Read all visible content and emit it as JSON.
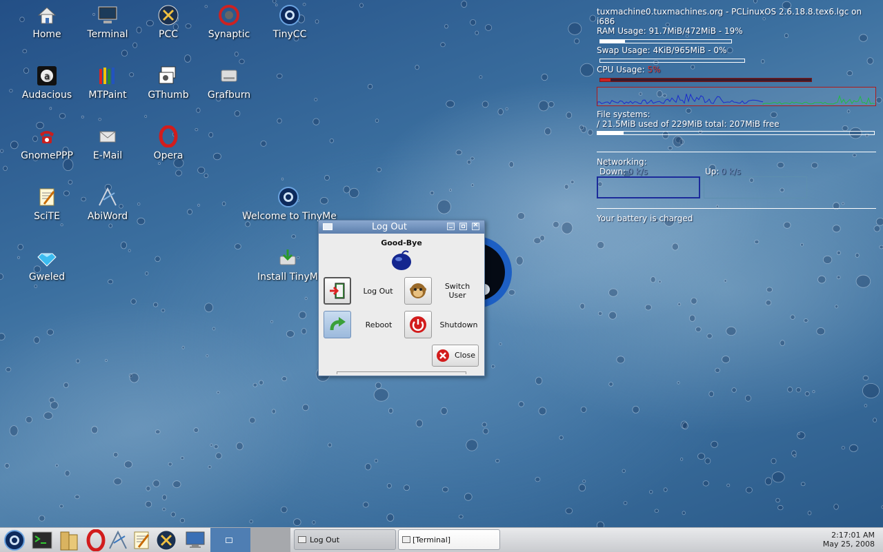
{
  "desktop_icons": [
    {
      "label": "Home",
      "icon": "home-icon"
    },
    {
      "label": "Terminal",
      "icon": "terminal-icon"
    },
    {
      "label": "PCC",
      "icon": "pcc-tools-icon"
    },
    {
      "label": "Synaptic",
      "icon": "synaptic-icon"
    },
    {
      "label": "TinyCC",
      "icon": "tinycc-icon"
    },
    {
      "label": "Audacious",
      "icon": "audacious-icon"
    },
    {
      "label": "MTPaint",
      "icon": "mtpaint-icon"
    },
    {
      "label": "GThumb",
      "icon": "gthumb-icon"
    },
    {
      "label": "Grafburn",
      "icon": "grafburn-icon"
    },
    {
      "label": "GnomePPP",
      "icon": "phone-icon"
    },
    {
      "label": "E-Mail",
      "icon": "email-icon"
    },
    {
      "label": "Opera",
      "icon": "opera-icon"
    },
    {
      "label": "SciTE",
      "icon": "scite-icon"
    },
    {
      "label": "AbiWord",
      "icon": "abiword-icon"
    },
    {
      "label": "Gweled",
      "icon": "gem-icon"
    },
    {
      "label": "Welcome to TinyMe",
      "icon": "tinyme-icon"
    },
    {
      "label": "Install TinyMe",
      "icon": "install-icon"
    }
  ],
  "conky": {
    "host_line": "tuxmachine0.tuxmachines.org - PCLinuxOS 2.6.18.8.tex6.lgc on i686",
    "ram": {
      "label": "RAM Usage: 91.7MiB/472MiB - 19%",
      "fraction": 0.19
    },
    "swap": {
      "label": "Swap Usage: 4KiB/965MiB - 0%",
      "fraction": 0.0
    },
    "cpu": {
      "label": "CPU Usage:",
      "value": "5%",
      "fraction": 0.05
    },
    "fs_title": "File systems:",
    "fs_line": " / 21.5MiB used of 229MiB total: 207MiB free",
    "fs_fraction": 0.094,
    "net_title": "Networking:",
    "down_label": "Down:",
    "down_value": "0 k/s",
    "up_label": "Up:",
    "up_value": "0 k/s",
    "battery": "Your battery is charged",
    "colors": {
      "cpu": "#cc2222",
      "graph_blue": "#1a2acc",
      "graph_green": "#22bb44",
      "net_value": "#6a88b8"
    }
  },
  "logout_window": {
    "title": "Log Out",
    "heading": "Good-Bye",
    "options": [
      {
        "label": "Log Out",
        "icon": "logout-door-icon"
      },
      {
        "label": "Switch User",
        "icon": "monkey-icon"
      },
      {
        "label": "Reboot",
        "icon": "reboot-arrow-icon"
      },
      {
        "label": "Shutdown",
        "icon": "power-icon"
      }
    ],
    "close_label": "Close"
  },
  "taskbar": {
    "launchers": [
      "tinyme-menu-icon",
      "terminal-icon",
      "folder-icon",
      "opera-icon",
      "abiword-icon",
      "scite-icon",
      "pcc-tools-icon",
      "monitor-icon"
    ],
    "tasks": [
      {
        "label": "Log Out",
        "active": true
      },
      {
        "label": "[Terminal]",
        "active": false
      }
    ],
    "clock_time": "2:17:01 AM",
    "clock_date": "May 25, 2008"
  }
}
